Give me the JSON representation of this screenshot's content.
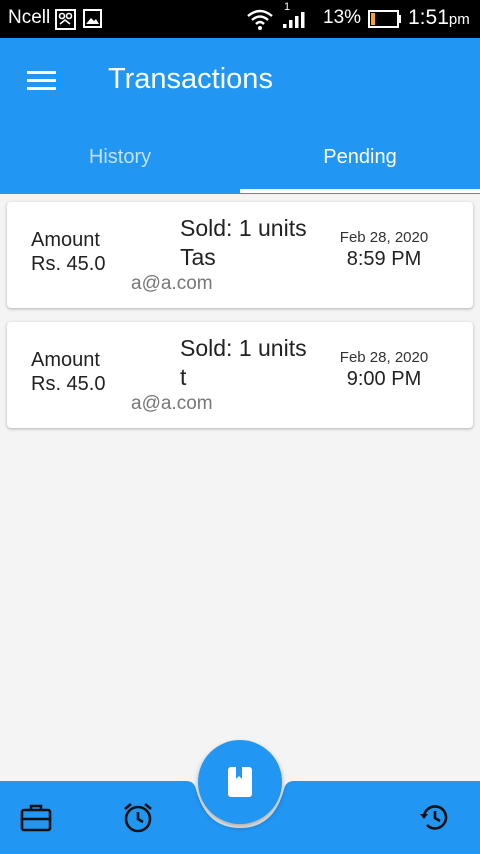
{
  "status_bar": {
    "carrier": "Ncell",
    "battery": "13%",
    "time": "1:51",
    "ampm": "pm",
    "sim_badge": "1",
    "icons": [
      "sim-card-icon",
      "image-icon",
      "wifi-icon",
      "signal-icon",
      "battery-icon"
    ]
  },
  "app_bar": {
    "title": "Transactions",
    "menu_icon": "hamburger-menu-icon"
  },
  "tabs": [
    {
      "label": "History",
      "active": false
    },
    {
      "label": "Pending",
      "active": true
    }
  ],
  "transactions": [
    {
      "amount_label": "Amount",
      "amount_value": "Rs. 45.0",
      "sold": "Sold: 1 units",
      "item": "Tas",
      "email": "a@a.com",
      "date": "Feb 28, 2020",
      "time": "8:59 PM"
    },
    {
      "amount_label": "Amount",
      "amount_value": "Rs. 45.0",
      "sold": "Sold: 1 units",
      "item": "t",
      "email": "a@a.com",
      "date": "Feb 28, 2020",
      "time": "9:00 PM"
    }
  ],
  "bottom_nav": {
    "icons": [
      "briefcase-icon",
      "alarm-clock-icon",
      "book-icon",
      "history-icon"
    ]
  },
  "colors": {
    "primary": "#2196f3",
    "background": "#f4f4f4",
    "card": "#ffffff",
    "status_bar": "#000000",
    "battery_level": "#f5a623"
  }
}
